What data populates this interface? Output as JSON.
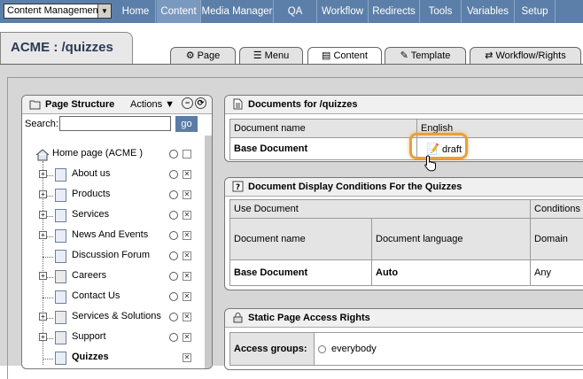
{
  "topnav": {
    "module_select": "Content Management",
    "items": [
      {
        "label": "Home",
        "active": false
      },
      {
        "label": "Content",
        "active": true
      },
      {
        "label": "Media Manager",
        "active": false
      },
      {
        "label": "QA",
        "active": false
      },
      {
        "label": "Workflow",
        "active": false
      },
      {
        "label": "Redirects",
        "active": false
      },
      {
        "label": "Tools",
        "active": false
      },
      {
        "label": "Variables",
        "active": false
      },
      {
        "label": "Setup",
        "active": false
      }
    ]
  },
  "page_title": "ACME : /quizzes",
  "subtabs": [
    {
      "label": "Page",
      "icon": "gear-icon"
    },
    {
      "label": "Menu",
      "icon": "menu-icon"
    },
    {
      "label": "Content",
      "icon": "document-icon",
      "active": true
    },
    {
      "label": "Template",
      "icon": "template-icon"
    },
    {
      "label": "Workflow/Rights",
      "icon": "workflow-icon"
    }
  ],
  "page_structure": {
    "title": "Page Structure",
    "actions_label": "Actions",
    "search_label": "Search:",
    "search_value": "",
    "go_label": "go",
    "root": "Home page (ACME )",
    "items": [
      {
        "label": "About us",
        "expandable": true,
        "special": false,
        "bold": false
      },
      {
        "label": "Products",
        "expandable": true,
        "special": false,
        "bold": false
      },
      {
        "label": "Services",
        "expandable": true,
        "special": false,
        "bold": false
      },
      {
        "label": "News And Events",
        "expandable": true,
        "special": false,
        "bold": false
      },
      {
        "label": "Discussion Forum",
        "expandable": false,
        "special": false,
        "bold": false
      },
      {
        "label": "Careers",
        "expandable": true,
        "special": true,
        "bold": false
      },
      {
        "label": "Contact Us",
        "expandable": false,
        "special": false,
        "bold": false
      },
      {
        "label": "Services & Solutions",
        "expandable": true,
        "special": true,
        "bold": false
      },
      {
        "label": "Support",
        "expandable": true,
        "special": true,
        "bold": false
      },
      {
        "label": "Quizzes",
        "expandable": false,
        "special": false,
        "bold": true
      }
    ]
  },
  "documents": {
    "title": "Documents for /quizzes",
    "col_name": "Document name",
    "col_lang": "English",
    "row_name": "Base Document",
    "row_status": "draft"
  },
  "conditions": {
    "title": "Document Display Conditions For the Quizzes",
    "use_document": "Use Document",
    "conditions": "Conditions",
    "col_name": "Document name",
    "col_lang": "Document language",
    "col_domain": "Domain",
    "row_name": "Base Document",
    "row_lang": "Auto",
    "row_domain": "Any"
  },
  "access": {
    "title": "Static Page Access Rights",
    "label": "Access groups:",
    "value": "everybody"
  },
  "colors": {
    "nav_bg": "#5b7fa8",
    "highlight": "#e8a03a"
  }
}
